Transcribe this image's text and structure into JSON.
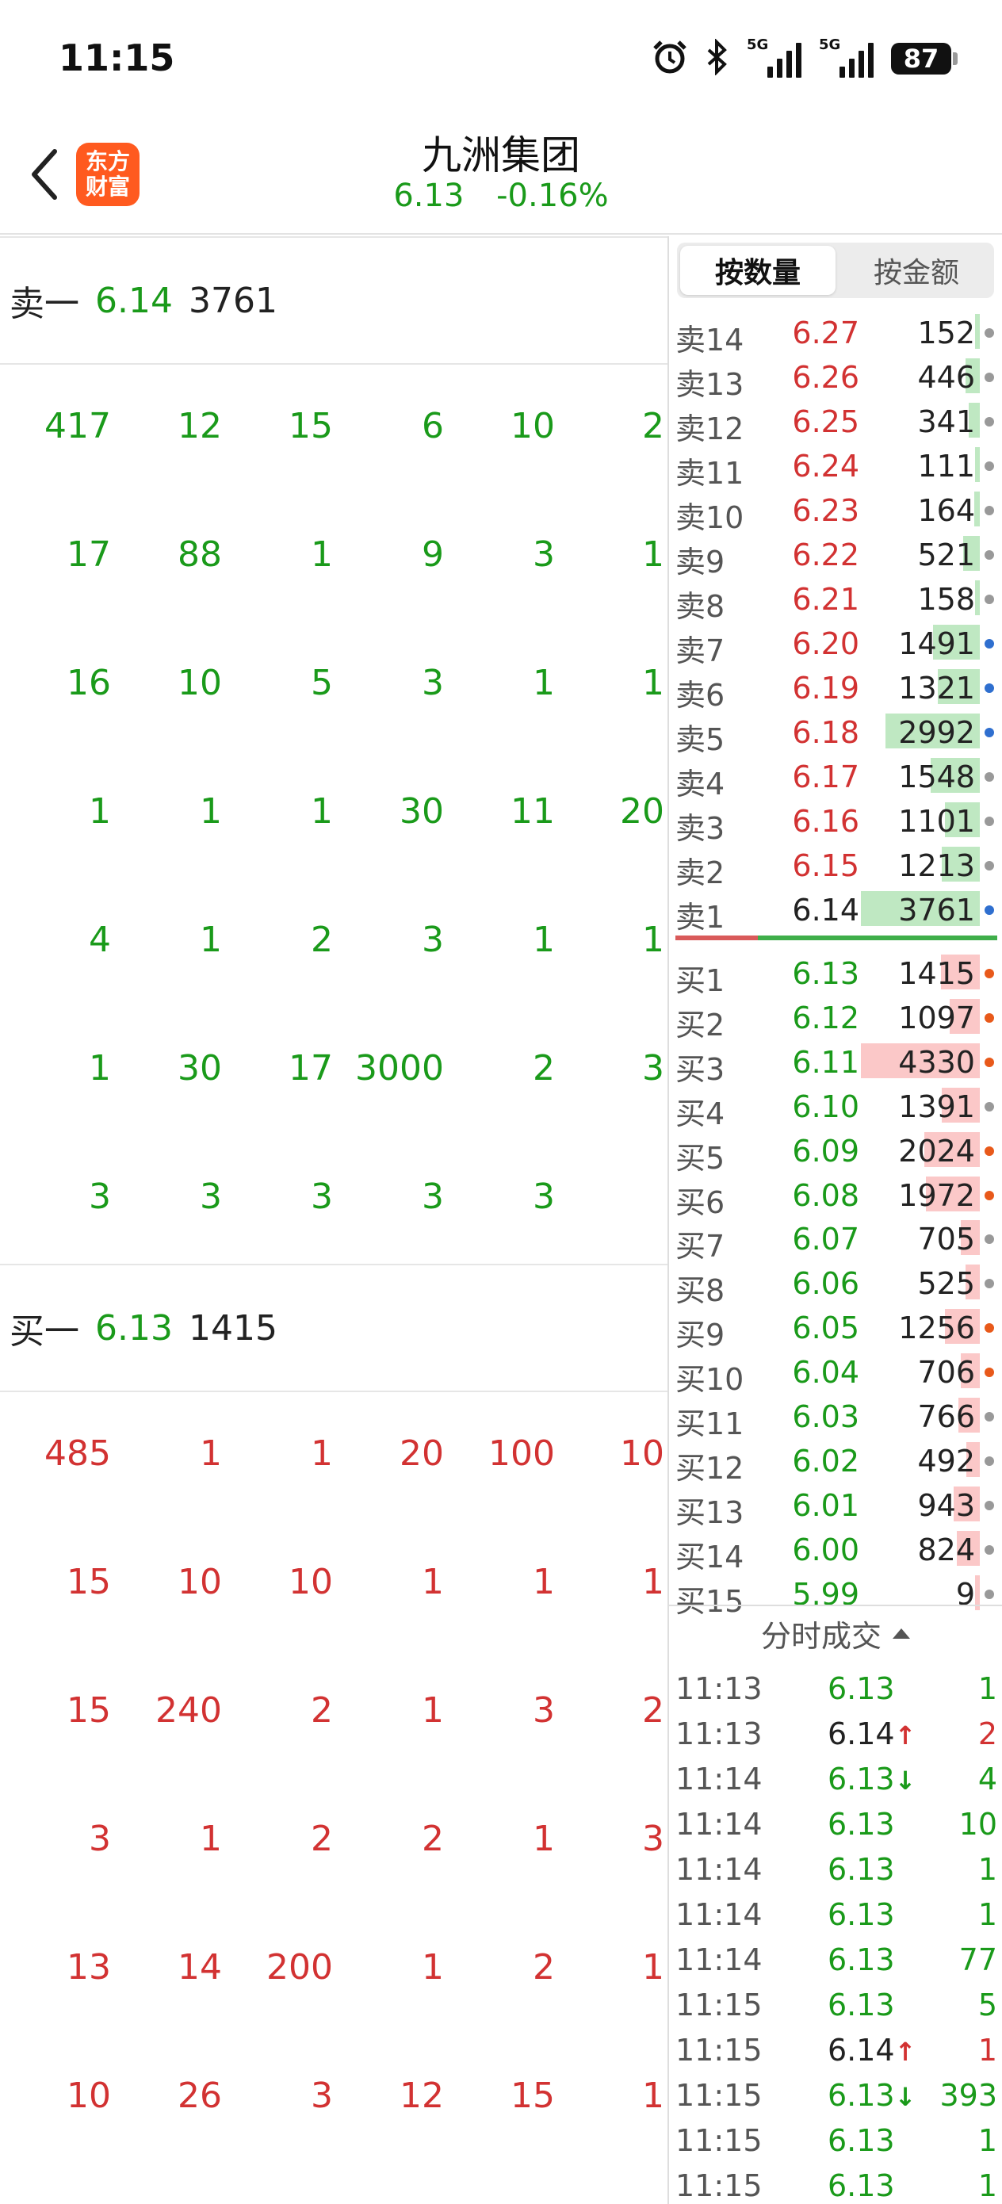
{
  "status_bar": {
    "time": "11:15",
    "icons": [
      "alarm-icon",
      "bluetooth-icon",
      "signal-5g-icon",
      "signal-5g-icon"
    ],
    "network_1": "5G",
    "network_2": "5G",
    "battery": "87"
  },
  "header": {
    "stock_name": "九洲集团",
    "price": "6.13",
    "change_pct": "-0.16%",
    "logo_line1": "东方",
    "logo_line2": "财富"
  },
  "left": {
    "sell_level": {
      "label": "卖一",
      "price": "6.14",
      "volume": "3761"
    },
    "sell_queue": [
      [
        "417",
        "12",
        "15",
        "6",
        "10",
        "2"
      ],
      [
        "17",
        "88",
        "1",
        "9",
        "3",
        "1"
      ],
      [
        "16",
        "10",
        "5",
        "3",
        "1",
        "1"
      ],
      [
        "1",
        "1",
        "1",
        "30",
        "11",
        "20"
      ],
      [
        "4",
        "1",
        "2",
        "3",
        "1",
        "1"
      ],
      [
        "1",
        "30",
        "17",
        "3000",
        "2",
        "3"
      ],
      [
        "3",
        "3",
        "3",
        "3",
        "3",
        ""
      ]
    ],
    "buy_level": {
      "label": "买一",
      "price": "6.13",
      "volume": "1415"
    },
    "buy_queue": [
      [
        "485",
        "1",
        "1",
        "20",
        "100",
        "10"
      ],
      [
        "15",
        "10",
        "10",
        "1",
        "1",
        "1"
      ],
      [
        "15",
        "240",
        "2",
        "1",
        "3",
        "2"
      ],
      [
        "3",
        "1",
        "2",
        "2",
        "1",
        "3"
      ],
      [
        "13",
        "14",
        "200",
        "1",
        "2",
        "1"
      ],
      [
        "10",
        "26",
        "3",
        "12",
        "15",
        "1"
      ]
    ]
  },
  "right": {
    "tabs": [
      {
        "label": "按数量"
      },
      {
        "label": "按金额"
      }
    ],
    "sell_orders": [
      {
        "label": "卖14",
        "price": "6.27",
        "volume": "152",
        "dot": "gray"
      },
      {
        "label": "卖13",
        "price": "6.26",
        "volume": "446",
        "dot": "gray"
      },
      {
        "label": "卖12",
        "price": "6.25",
        "volume": "341",
        "dot": "gray"
      },
      {
        "label": "卖11",
        "price": "6.24",
        "volume": "111",
        "dot": "gray"
      },
      {
        "label": "卖10",
        "price": "6.23",
        "volume": "164",
        "dot": "gray"
      },
      {
        "label": "卖9",
        "price": "6.22",
        "volume": "521",
        "dot": "gray"
      },
      {
        "label": "卖8",
        "price": "6.21",
        "volume": "158",
        "dot": "gray"
      },
      {
        "label": "卖7",
        "price": "6.20",
        "volume": "1491",
        "dot": "blue"
      },
      {
        "label": "卖6",
        "price": "6.19",
        "volume": "1321",
        "dot": "blue"
      },
      {
        "label": "卖5",
        "price": "6.18",
        "volume": "2992",
        "dot": "blue"
      },
      {
        "label": "卖4",
        "price": "6.17",
        "volume": "1548",
        "dot": "gray"
      },
      {
        "label": "卖3",
        "price": "6.16",
        "volume": "1101",
        "dot": "gray"
      },
      {
        "label": "卖2",
        "price": "6.15",
        "volume": "1213",
        "dot": "gray"
      },
      {
        "label": "卖1",
        "price": "6.14",
        "volume": "3761",
        "dot": "blue"
      }
    ],
    "buy_orders": [
      {
        "label": "买1",
        "price": "6.13",
        "volume": "1415",
        "dot": "orange"
      },
      {
        "label": "买2",
        "price": "6.12",
        "volume": "1097",
        "dot": "orange"
      },
      {
        "label": "买3",
        "price": "6.11",
        "volume": "4330",
        "dot": "orange"
      },
      {
        "label": "买4",
        "price": "6.10",
        "volume": "1391",
        "dot": "gray"
      },
      {
        "label": "买5",
        "price": "6.09",
        "volume": "2024",
        "dot": "orange"
      },
      {
        "label": "买6",
        "price": "6.08",
        "volume": "1972",
        "dot": "orange"
      },
      {
        "label": "买7",
        "price": "6.07",
        "volume": "705",
        "dot": "gray"
      },
      {
        "label": "买8",
        "price": "6.06",
        "volume": "525",
        "dot": "gray"
      },
      {
        "label": "买9",
        "price": "6.05",
        "volume": "1256",
        "dot": "orange"
      },
      {
        "label": "买10",
        "price": "6.04",
        "volume": "706",
        "dot": "orange"
      },
      {
        "label": "买11",
        "price": "6.03",
        "volume": "766",
        "dot": "gray"
      },
      {
        "label": "买12",
        "price": "6.02",
        "volume": "492",
        "dot": "gray"
      },
      {
        "label": "买13",
        "price": "6.01",
        "volume": "943",
        "dot": "gray"
      },
      {
        "label": "买14",
        "price": "6.00",
        "volume": "824",
        "dot": "gray"
      },
      {
        "label": "买15",
        "price": "5.99",
        "volume": "9",
        "dot": "gray"
      }
    ],
    "trades_title": "分时成交",
    "trades": [
      {
        "time": "11:13",
        "price": "6.13",
        "arrow": "",
        "volume": "1",
        "side": "down"
      },
      {
        "time": "11:13",
        "price": "6.14",
        "arrow": "↑",
        "volume": "2",
        "side": "up"
      },
      {
        "time": "11:14",
        "price": "6.13",
        "arrow": "↓",
        "volume": "4",
        "side": "down"
      },
      {
        "time": "11:14",
        "price": "6.13",
        "arrow": "",
        "volume": "10",
        "side": "down"
      },
      {
        "time": "11:14",
        "price": "6.13",
        "arrow": "",
        "volume": "1",
        "side": "down"
      },
      {
        "time": "11:14",
        "price": "6.13",
        "arrow": "",
        "volume": "1",
        "side": "down"
      },
      {
        "time": "11:14",
        "price": "6.13",
        "arrow": "",
        "volume": "77",
        "side": "down"
      },
      {
        "time": "11:15",
        "price": "6.13",
        "arrow": "",
        "volume": "5",
        "side": "down"
      },
      {
        "time": "11:15",
        "price": "6.14",
        "arrow": "↑",
        "volume": "1",
        "side": "up"
      },
      {
        "time": "11:15",
        "price": "6.13",
        "arrow": "↓",
        "volume": "393",
        "side": "down"
      },
      {
        "time": "11:15",
        "price": "6.13",
        "arrow": "",
        "volume": "1",
        "side": "down"
      },
      {
        "time": "11:15",
        "price": "6.13",
        "arrow": "",
        "volume": "1",
        "side": "down"
      }
    ]
  },
  "colors": {
    "up_red": "#d23232",
    "down_green": "#1a9a1a",
    "dot_gray": "#999999",
    "dot_blue": "#2f6fcf",
    "dot_orange": "#e8591a",
    "logo_orange": "#ff5a1f"
  }
}
